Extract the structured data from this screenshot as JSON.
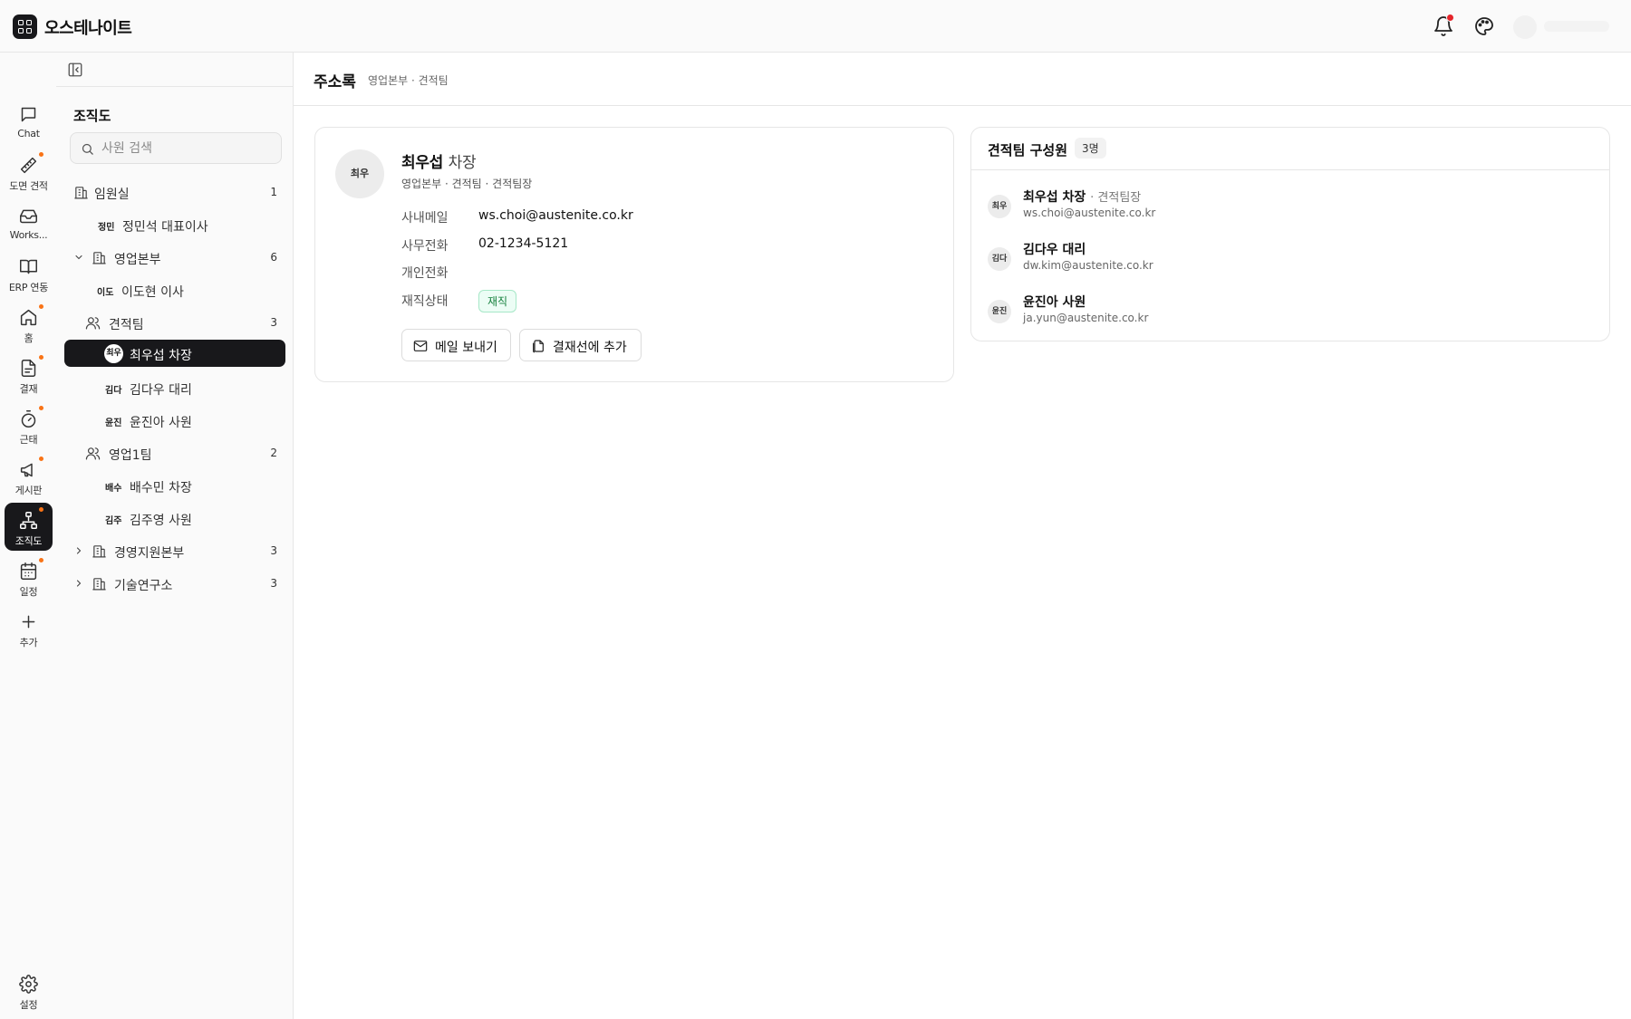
{
  "app": {
    "title": "오스테나이트"
  },
  "rail": {
    "items": [
      {
        "label": "Chat",
        "icon": "chat-icon",
        "dot": false
      },
      {
        "label": "도면 견적",
        "icon": "ruler-icon",
        "dot": true
      },
      {
        "label": "Works...",
        "icon": "inbox-icon",
        "dot": false
      },
      {
        "label": "ERP 연동",
        "icon": "book-icon",
        "dot": false
      },
      {
        "label": "홈",
        "icon": "home-icon",
        "dot": true
      },
      {
        "label": "결재",
        "icon": "document-icon",
        "dot": true
      },
      {
        "label": "근태",
        "icon": "timer-icon",
        "dot": true
      },
      {
        "label": "게시판",
        "icon": "megaphone-icon",
        "dot": true
      },
      {
        "label": "조직도",
        "icon": "org-chart-icon",
        "dot": true,
        "active": true
      },
      {
        "label": "일정",
        "icon": "calendar-icon",
        "dot": true
      },
      {
        "label": "추가",
        "icon": "plus-icon",
        "dot": false
      }
    ],
    "settings_label": "설정"
  },
  "tree": {
    "title": "조직도",
    "search_placeholder": "사원 검색",
    "nodes": [
      {
        "type": "dept",
        "label": "임원실",
        "count": "1"
      },
      {
        "type": "person",
        "mini": "정민",
        "label": "정민석 대표이사"
      },
      {
        "type": "dept",
        "label": "영업본부",
        "count": "6",
        "expanded": true
      },
      {
        "type": "person",
        "mini": "이도",
        "label": "이도현 이사"
      },
      {
        "type": "team",
        "label": "견적팀",
        "count": "3"
      },
      {
        "type": "person",
        "mini": "최우",
        "label": "최우섭 차장",
        "selected": true
      },
      {
        "type": "person",
        "mini": "김다",
        "label": "김다우 대리"
      },
      {
        "type": "person",
        "mini": "윤진",
        "label": "윤진아 사원"
      },
      {
        "type": "team",
        "label": "영업1팀",
        "count": "2"
      },
      {
        "type": "person",
        "mini": "배수",
        "label": "배수민 차장"
      },
      {
        "type": "person",
        "mini": "김주",
        "label": "김주영 사원"
      },
      {
        "type": "dept",
        "label": "경영지원본부",
        "count": "3",
        "expanded": false
      },
      {
        "type": "dept",
        "label": "기술연구소",
        "count": "3",
        "expanded": false
      }
    ]
  },
  "main": {
    "title": "주소록",
    "breadcrumb": "영업본부 · 견적팀"
  },
  "detail": {
    "avatar": "최우",
    "name": "최우섭",
    "rank": "차장",
    "path": "영업본부 · 견적팀 · 견적팀장",
    "rows": [
      {
        "label": "사내메일",
        "value": "ws.choi@austenite.co.kr"
      },
      {
        "label": "사무전화",
        "value": "02-1234-5121"
      },
      {
        "label": "개인전화",
        "value": ""
      },
      {
        "label": "재직상태",
        "value": ""
      }
    ],
    "status": "재직",
    "buttons": {
      "mail": "메일 보내기",
      "approval": "결재선에 추가"
    }
  },
  "members": {
    "title": "견적팀 구성원",
    "count": "3명",
    "list": [
      {
        "avatar": "최우",
        "name": "최우섭 차장",
        "role": "· 견적팀장",
        "email": "ws.choi@austenite.co.kr"
      },
      {
        "avatar": "김다",
        "name": "김다우 대리",
        "role": "",
        "email": "dw.kim@austenite.co.kr"
      },
      {
        "avatar": "윤진",
        "name": "윤진아 사원",
        "role": "",
        "email": "ja.yun@austenite.co.kr"
      }
    ]
  },
  "colors": {
    "accent": "#18181b",
    "notification": "#e5242a",
    "badge_dot": "#f97316",
    "status_green": "#15803d"
  }
}
